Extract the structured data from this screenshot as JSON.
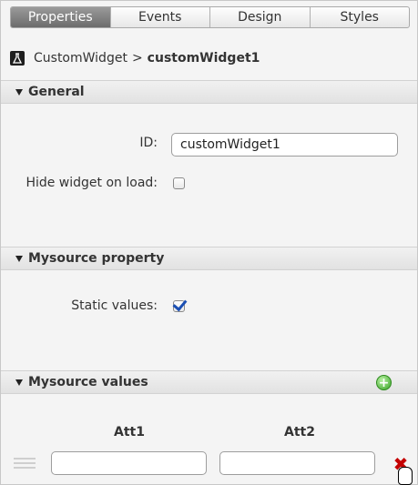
{
  "tabs": [
    {
      "label": "Properties",
      "active": true
    },
    {
      "label": "Events",
      "active": false
    },
    {
      "label": "Design",
      "active": false
    },
    {
      "label": "Styles",
      "active": false
    }
  ],
  "breadcrumb": {
    "widget_type": "CustomWidget",
    "separator": ">",
    "widget_name": "customWidget1"
  },
  "sections": {
    "general": {
      "title": "General",
      "id_label": "ID:",
      "id_value": "customWidget1",
      "hide_label": "Hide widget on load:",
      "hide_checked": false
    },
    "mysource_property": {
      "title": "Mysource property",
      "static_label": "Static values:",
      "static_checked": true
    },
    "mysource_values": {
      "title": "Mysource values",
      "columns": [
        "Att1",
        "Att2"
      ],
      "rows": [
        {
          "att1": "",
          "att2": ""
        }
      ]
    }
  },
  "colors": {
    "active_tab": "#7a7a7a",
    "checkmark": "#1b4fb3",
    "add": "#3da52a",
    "remove": "#c40000"
  }
}
